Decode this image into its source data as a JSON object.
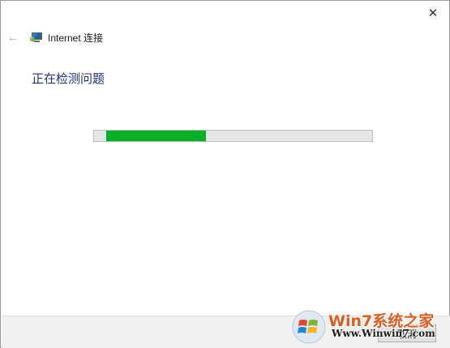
{
  "window": {
    "title": "Internet 连接",
    "close_glyph": "✕",
    "back_glyph": "←"
  },
  "main": {
    "heading": "正在检测问题",
    "progress_fraction": 0.36,
    "progress_color": "#06b025"
  },
  "footer": {
    "cancel_label": "取消"
  },
  "watermark": {
    "brand": "Win7系统之家",
    "url": "Www.Winwin7.com"
  },
  "colors": {
    "heading": "#1e3287",
    "progress_track": "#e6e6e6",
    "footer_bg": "#f0f0f0"
  }
}
